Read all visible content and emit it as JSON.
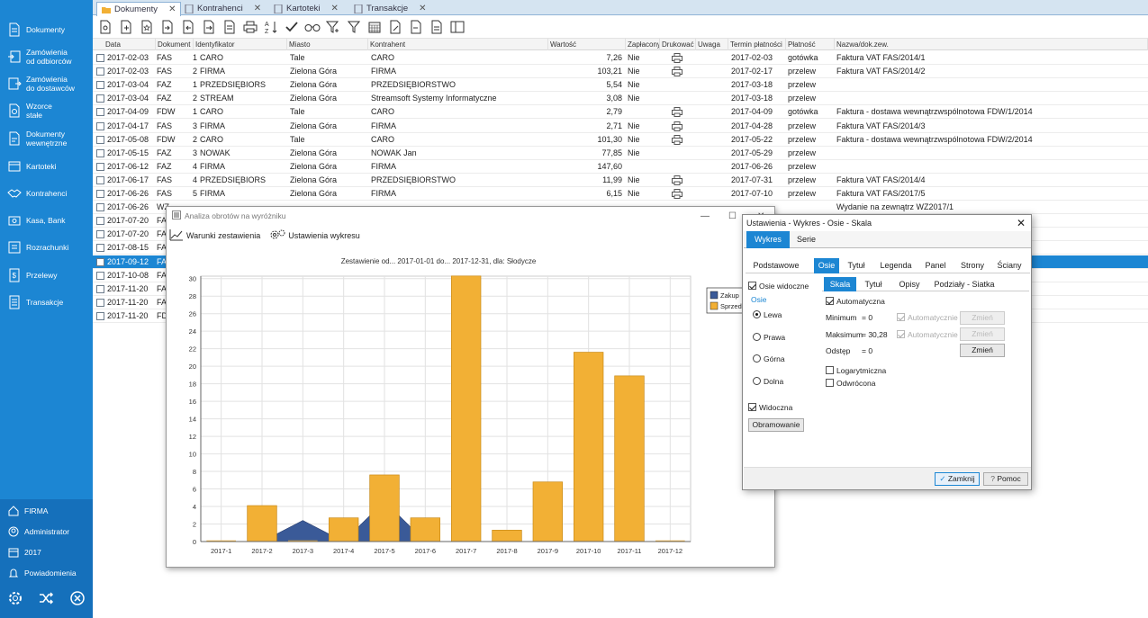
{
  "sidebar": {
    "items": [
      {
        "label": "Dokumenty",
        "icon": "document-icon"
      },
      {
        "label": "Zamówienia\nod odbiorców",
        "icon": "order-in-icon"
      },
      {
        "label": "Zamówienia\ndo dostawców",
        "icon": "order-out-icon"
      },
      {
        "label": "Wzorce\nstałe",
        "icon": "template-icon"
      },
      {
        "label": "Dokumenty\nwewnętrzne",
        "icon": "internal-doc-icon"
      },
      {
        "label": "Kartoteki",
        "icon": "cards-icon"
      },
      {
        "label": "Kontrahenci",
        "icon": "handshake-icon"
      },
      {
        "label": "Kasa, Bank",
        "icon": "cash-icon"
      },
      {
        "label": "Rozrachunki",
        "icon": "settlements-icon"
      },
      {
        "label": "Przelewy",
        "icon": "transfer-icon"
      },
      {
        "label": "Transakcje",
        "icon": "transactions-icon"
      }
    ],
    "bottom": [
      {
        "label": "FIRMA",
        "icon": "home-icon"
      },
      {
        "label": "Administrator",
        "icon": "user-icon"
      },
      {
        "label": "2017",
        "icon": "calendar-icon"
      },
      {
        "label": "Powiadomienia",
        "icon": "bell-icon"
      }
    ]
  },
  "tabs": [
    "Dokumenty",
    "Kontrahenci",
    "Kartoteki",
    "Transakcje"
  ],
  "columns": [
    "Data",
    "Dokument",
    "Identyfikator",
    "Miasto",
    "Kontrahent",
    "Wartość",
    "Zapłacony",
    "Drukować",
    "Uwaga",
    "Termin płatności",
    "Płatność",
    "Nazwa/dok.zew."
  ],
  "rows": [
    {
      "date": "2017-02-03",
      "doc": "FAS",
      "num": "1",
      "id": "CARO",
      "city": "Tale",
      "contractor": "CARO",
      "value": "7,26",
      "paid": "Nie",
      "print": true,
      "due": "2017-02-03",
      "payment": "gotówka",
      "name": "Faktura VAT FAS/2014/1"
    },
    {
      "date": "2017-02-03",
      "doc": "FAS",
      "num": "2",
      "id": "FIRMA",
      "city": "Zielona Góra",
      "contractor": "FIRMA",
      "value": "103,21",
      "paid": "Nie",
      "print": true,
      "due": "2017-02-17",
      "payment": "przelew",
      "name": "Faktura VAT FAS/2014/2"
    },
    {
      "date": "2017-03-04",
      "doc": "FAZ",
      "num": "1",
      "id": "PRZEDSIĘBIORS",
      "city": "Zielona Góra",
      "contractor": "PRZEDSIĘBIORSTWO",
      "value": "5,54",
      "paid": "Nie",
      "print": false,
      "due": "2017-03-18",
      "payment": "przelew",
      "name": ""
    },
    {
      "date": "2017-03-04",
      "doc": "FAZ",
      "num": "2",
      "id": "STREAM",
      "city": "Zielona Góra",
      "contractor": "Streamsoft Systemy Informatyczne",
      "value": "3,08",
      "paid": "Nie",
      "print": false,
      "due": "2017-03-18",
      "payment": "przelew",
      "name": ""
    },
    {
      "date": "2017-04-09",
      "doc": "FDW",
      "num": "1",
      "id": "CARO",
      "city": "Tale",
      "contractor": "CARO",
      "value": "2,79",
      "paid": "",
      "print": true,
      "due": "2017-04-09",
      "payment": "gotówka",
      "name": "Faktura - dostawa wewnątrzwspólnotowa FDW/1/2014"
    },
    {
      "date": "2017-04-17",
      "doc": "FAS",
      "num": "3",
      "id": "FIRMA",
      "city": "Zielona Góra",
      "contractor": "FIRMA",
      "value": "2,71",
      "paid": "Nie",
      "print": true,
      "due": "2017-04-28",
      "payment": "przelew",
      "name": "Faktura VAT FAS/2014/3"
    },
    {
      "date": "2017-05-08",
      "doc": "FDW",
      "num": "2",
      "id": "CARO",
      "city": "Tale",
      "contractor": "CARO",
      "value": "101,30",
      "paid": "Nie",
      "print": true,
      "due": "2017-05-22",
      "payment": "przelew",
      "name": "Faktura - dostawa wewnątrzwspólnotowa FDW/2/2014"
    },
    {
      "date": "2017-05-15",
      "doc": "FAZ",
      "num": "3",
      "id": "NOWAK",
      "city": "Zielona Góra",
      "contractor": "NOWAK Jan",
      "value": "77,85",
      "paid": "Nie",
      "print": false,
      "due": "2017-05-29",
      "payment": "przelew",
      "name": ""
    },
    {
      "date": "2017-06-12",
      "doc": "FAZ",
      "num": "4",
      "id": "FIRMA",
      "city": "Zielona Góra",
      "contractor": "FIRMA",
      "value": "147,60",
      "paid": "",
      "print": false,
      "due": "2017-06-26",
      "payment": "przelew",
      "name": ""
    },
    {
      "date": "2017-06-17",
      "doc": "FAS",
      "num": "4",
      "id": "PRZEDSIĘBIORS",
      "city": "Zielona Góra",
      "contractor": "PRZEDSIĘBIORSTWO",
      "value": "11,99",
      "paid": "Nie",
      "print": true,
      "due": "2017-07-31",
      "payment": "przelew",
      "name": "Faktura VAT FAS/2014/4"
    },
    {
      "date": "2017-06-26",
      "doc": "FAS",
      "num": "5",
      "id": "FIRMA",
      "city": "Zielona Góra",
      "contractor": "FIRMA",
      "value": "6,15",
      "paid": "Nie",
      "print": true,
      "due": "2017-07-10",
      "payment": "przelew",
      "name": "Faktura VAT FAS/2017/5"
    },
    {
      "date": "2017-06-26",
      "doc": "WZ",
      "num": "",
      "id": "",
      "city": "",
      "contractor": "",
      "value": "",
      "paid": "",
      "print": false,
      "due": "",
      "payment": "",
      "name": "Wydanie na zewnątrz WZ2017/1"
    },
    {
      "date": "2017-07-20",
      "doc": "FA",
      "num": "",
      "id": "",
      "city": "",
      "contractor": "",
      "value": "",
      "paid": "",
      "print": false,
      "due": "",
      "payment": "",
      "name": ""
    },
    {
      "date": "2017-07-20",
      "doc": "FA",
      "num": "",
      "id": "",
      "city": "",
      "contractor": "",
      "value": "",
      "paid": "",
      "print": false,
      "due": "",
      "payment": "",
      "name": ""
    },
    {
      "date": "2017-08-15",
      "doc": "FA",
      "num": "",
      "id": "",
      "city": "",
      "contractor": "",
      "value": "",
      "paid": "",
      "print": false,
      "due": "",
      "payment": "",
      "name": ""
    },
    {
      "date": "2017-09-12",
      "doc": "FA",
      "num": "",
      "id": "",
      "city": "",
      "contractor": "",
      "value": "",
      "paid": "",
      "print": false,
      "due": "",
      "payment": "",
      "name": "",
      "selected": true
    },
    {
      "date": "2017-10-08",
      "doc": "FA",
      "num": "",
      "id": "",
      "city": "",
      "contractor": "",
      "value": "",
      "paid": "",
      "print": false,
      "due": "",
      "payment": "",
      "name": ""
    },
    {
      "date": "2017-11-20",
      "doc": "FA",
      "num": "",
      "id": "",
      "city": "",
      "contractor": "",
      "value": "",
      "paid": "",
      "print": false,
      "due": "",
      "payment": "",
      "name": ""
    },
    {
      "date": "2017-11-20",
      "doc": "FA",
      "num": "",
      "id": "",
      "city": "",
      "contractor": "",
      "value": "",
      "paid": "",
      "print": false,
      "due": "",
      "payment": "",
      "name": ""
    },
    {
      "date": "2017-11-20",
      "doc": "FD",
      "num": "",
      "id": "",
      "city": "",
      "contractor": "",
      "value": "",
      "paid": "",
      "print": false,
      "due": "",
      "payment": "",
      "name": ""
    }
  ],
  "chart_window": {
    "title": "Analiza obrotów na wyróżniku",
    "btn_conditions": "Warunki zestawienia",
    "btn_settings": "Ustawienia wykresu"
  },
  "chart_data": {
    "type": "bar",
    "title": "Zestawienie od... 2017-01-01  do... 2017-12-31, dla: Słodycze",
    "categories": [
      "2017-1",
      "2017-2",
      "2017-3",
      "2017-4",
      "2017-5",
      "2017-6",
      "2017-7",
      "2017-8",
      "2017-9",
      "2017-10",
      "2017-11",
      "2017-12"
    ],
    "series": [
      {
        "name": "Zakup",
        "type": "area",
        "color": "#3a5a98",
        "values": [
          0,
          0,
          2.4,
          0,
          4.6,
          0,
          0,
          0,
          0,
          0,
          0,
          0
        ]
      },
      {
        "name": "Sprzed",
        "type": "bar",
        "color": "#f2b035",
        "values": [
          0,
          4.1,
          0,
          2.7,
          7.6,
          2.7,
          30.3,
          1.3,
          6.8,
          21.6,
          18.9,
          0
        ]
      }
    ],
    "ylim": [
      0,
      30.28
    ],
    "yticks": [
      0,
      2,
      4,
      6,
      8,
      10,
      12,
      14,
      16,
      18,
      20,
      22,
      24,
      26,
      28,
      30
    ],
    "grid": true,
    "legend": "top-right"
  },
  "settings": {
    "title": "Ustawienia -  Wykres  -  Osie  -  Skala",
    "tabs": [
      "Wykres",
      "Serie"
    ],
    "subtabs": [
      "Podstawowe",
      "Osie",
      "Tytuł",
      "Legenda",
      "Panel",
      "Strony",
      "Ściany"
    ],
    "axis_visible": "Osie widoczne",
    "axis_group": "Osie",
    "axes": [
      "Lewa",
      "Prawa",
      "Górna",
      "Dolna"
    ],
    "scale_tabs": [
      "Skala",
      "Tytuł",
      "Opisy",
      "Podziały - Siatka"
    ],
    "automatic": "Automatyczna",
    "minimum": "Minimum",
    "minimum_value": "= 0",
    "maximum": "Maksimum",
    "maximum_value": "= 30,28",
    "step": "Odstęp",
    "step_value": "= 0",
    "auto_label": "Automatycznie",
    "change": "Zmień",
    "log": "Logarytmiczna",
    "inverted": "Odwrócona",
    "visible": "Widoczna",
    "border": "Obramowanie",
    "close_btn": "Zamknij",
    "help_btn": "Pomoc"
  }
}
